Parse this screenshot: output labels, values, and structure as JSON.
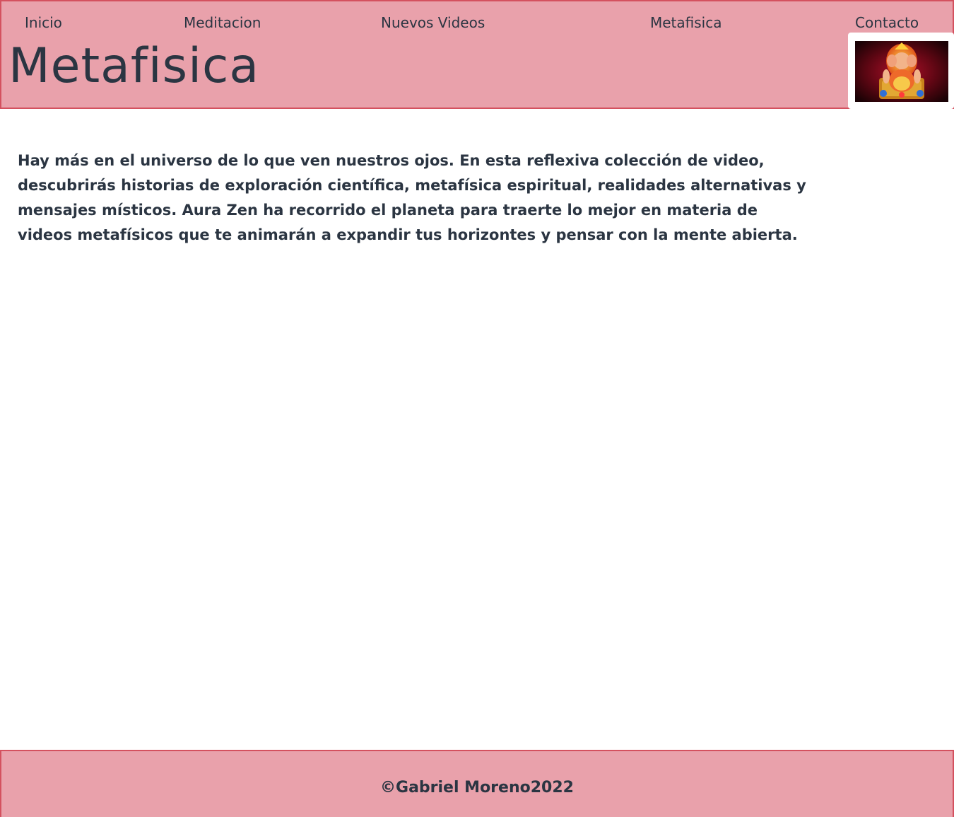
{
  "nav": {
    "items": [
      {
        "label": "Inicio"
      },
      {
        "label": "Meditacion"
      },
      {
        "label": "Nuevos Videos"
      },
      {
        "label": "Metafisica"
      },
      {
        "label": "Contacto"
      }
    ]
  },
  "header": {
    "title": "Metafisica",
    "logo": "ganesha-image"
  },
  "main": {
    "intro": "Hay más en el universo de lo que ven nuestros ojos. En esta reflexiva colección de video, descubrirás historias de exploración científica, metafísica espiritual, realidades alternativas y mensajes místicos. Aura Zen ha recorrido el planeta para traerte lo mejor en materia de videos metafísicos que te animarán a expandir tus horizontes y pensar con la mente abierta."
  },
  "footer": {
    "copyright": "©Gabriel Moreno2022"
  },
  "colors": {
    "header_bg": "#e9a1ab",
    "border": "#d4515f",
    "text": "#2b3542"
  }
}
